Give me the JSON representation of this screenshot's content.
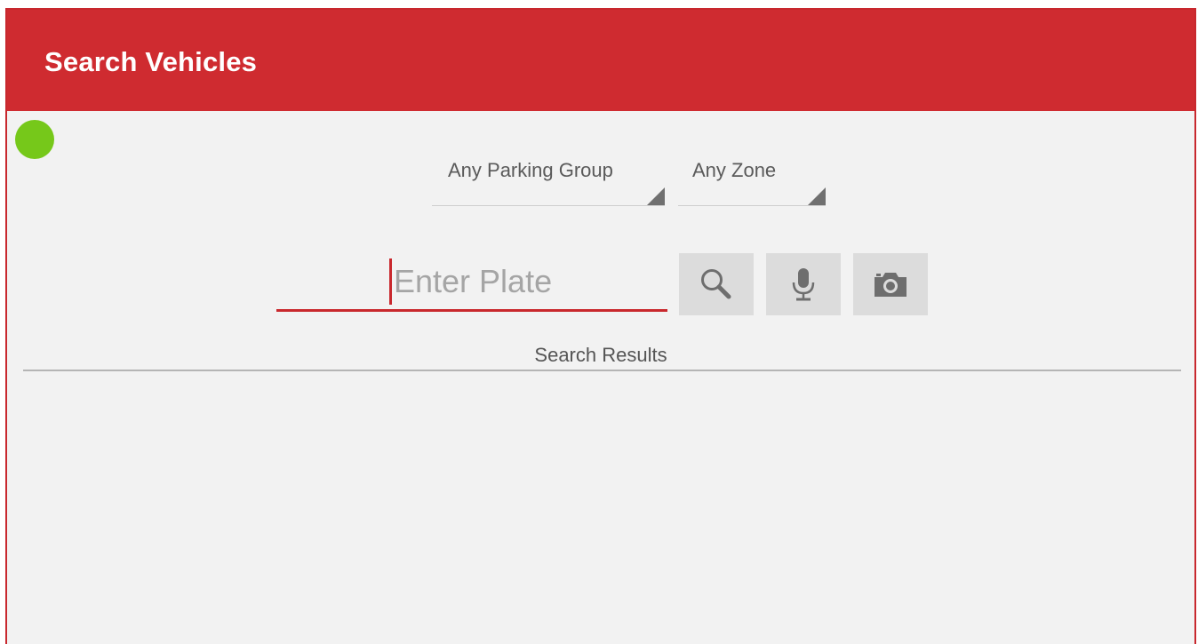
{
  "app_bar": {
    "title": "Search Vehicles",
    "color": "#cf2b30"
  },
  "status": {
    "indicator_color": "#76c81a",
    "icon": "status-dot"
  },
  "filters": {
    "parking_group": {
      "selected": "Any Parking Group"
    },
    "zone": {
      "selected": "Any Zone"
    }
  },
  "search": {
    "plate_value": "",
    "plate_placeholder": "Enter Plate",
    "accent_color": "#c9282d"
  },
  "actions": [
    {
      "name": "search",
      "icon": "search-icon"
    },
    {
      "name": "voice",
      "icon": "microphone-icon"
    },
    {
      "name": "camera",
      "icon": "camera-icon"
    }
  ],
  "results": {
    "label": "Search Results",
    "items": []
  }
}
